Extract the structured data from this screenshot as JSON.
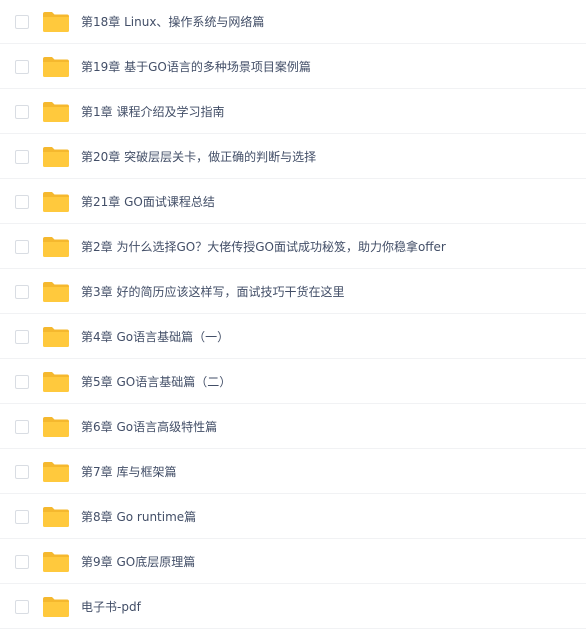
{
  "files": [
    {
      "name": "第18章 Linux、操作系统与网络篇"
    },
    {
      "name": "第19章 基于GO语言的多种场景项目案例篇"
    },
    {
      "name": "第1章 课程介绍及学习指南"
    },
    {
      "name": "第20章 突破层层关卡，做正确的判断与选择"
    },
    {
      "name": "第21章 GO面试课程总结"
    },
    {
      "name": "第2章 为什么选择GO？大佬传授GO面试成功秘笈，助力你稳拿offer"
    },
    {
      "name": "第3章 好的简历应该这样写，面试技巧干货在这里"
    },
    {
      "name": "第4章 Go语言基础篇（一）"
    },
    {
      "name": "第5章 GO语言基础篇（二）"
    },
    {
      "name": "第6章 Go语言高级特性篇"
    },
    {
      "name": "第7章 库与框架篇"
    },
    {
      "name": "第8章 Go runtime篇"
    },
    {
      "name": "第9章 GO底层原理篇"
    },
    {
      "name": "电子书-pdf"
    }
  ],
  "colors": {
    "folder": "#ffc93d",
    "folder_tab": "#f5b82e",
    "text": "#424e67",
    "divider": "#f1f2f4"
  }
}
